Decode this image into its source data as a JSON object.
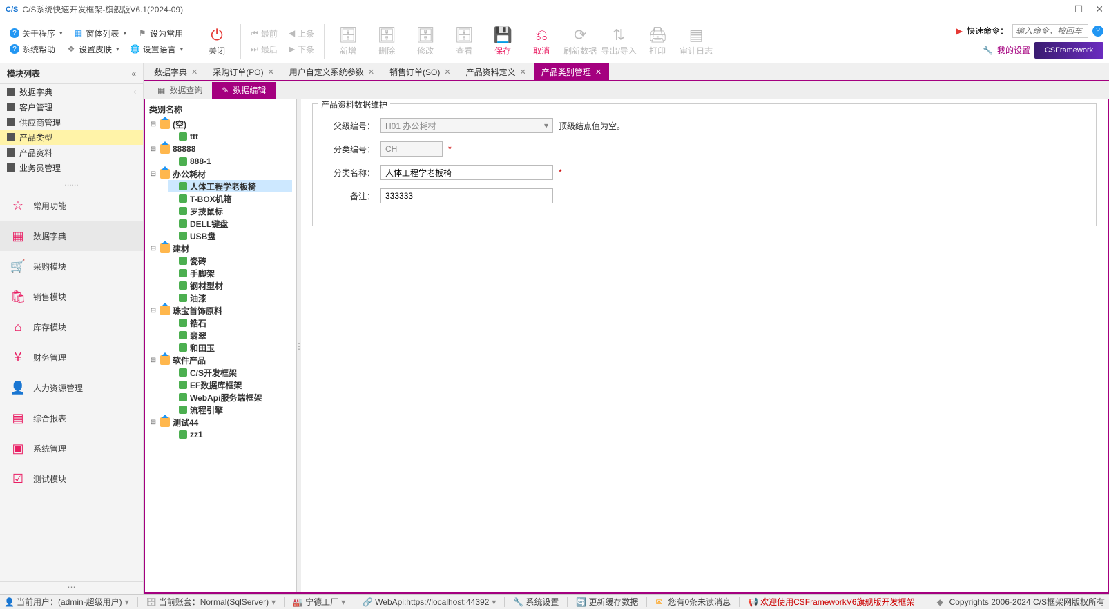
{
  "window": {
    "title": "C/S系统快速开发框架-旗舰版V6.1(2024-09)",
    "logo": "C/S"
  },
  "menu": {
    "about": "关于程序",
    "windows": "窗体列表",
    "set_default": "设为常用",
    "help": "系统帮助",
    "skin": "设置皮肤",
    "lang": "设置语言"
  },
  "nav": {
    "first": "最前",
    "prev": "上条",
    "last": "最后",
    "next": "下条"
  },
  "toolbar": {
    "close": "关闭",
    "add": "新增",
    "delete": "删除",
    "edit": "修改",
    "view": "查看",
    "save": "保存",
    "cancel": "取消",
    "refresh": "刷新数据",
    "export": "导出/导入",
    "print": "打印",
    "audit": "审计日志"
  },
  "quick": {
    "label": "快速命令：",
    "placeholder": "输入命令，按回车",
    "settings": "我的设置",
    "badge": "CSFramework"
  },
  "left": {
    "header": "模块列表",
    "items": [
      {
        "label": "数据字典",
        "chev": true
      },
      {
        "label": "客户管理"
      },
      {
        "label": "供应商管理"
      },
      {
        "label": "产品类型",
        "selected": true
      },
      {
        "label": "产品资料"
      },
      {
        "label": "业务员管理"
      }
    ],
    "ellipsis": "......",
    "big": [
      {
        "label": "常用功能",
        "icon": "☆"
      },
      {
        "label": "数据字典",
        "icon": "▦",
        "active": true
      },
      {
        "label": "采购模块",
        "icon": "🛒"
      },
      {
        "label": "销售模块",
        "icon": "🛍"
      },
      {
        "label": "库存模块",
        "icon": "⌂"
      },
      {
        "label": "财务管理",
        "icon": "¥"
      },
      {
        "label": "人力资源管理",
        "icon": "👤"
      },
      {
        "label": "综合报表",
        "icon": "▤"
      },
      {
        "label": "系统管理",
        "icon": "▣"
      },
      {
        "label": "测试模块",
        "icon": "☑"
      }
    ]
  },
  "tabs": [
    {
      "label": "数据字典",
      "close": true
    },
    {
      "label": "采购订单(PO)",
      "close": true
    },
    {
      "label": "用户自定义系统参数",
      "close": true
    },
    {
      "label": "销售订单(SO)",
      "close": true
    },
    {
      "label": "产品资料定义",
      "close": true
    },
    {
      "label": "产品类别管理",
      "close": true,
      "active": true
    }
  ],
  "subtabs": {
    "query": "数据查询",
    "edit": "数据编辑"
  },
  "tree": {
    "title": "类别名称",
    "nodes": [
      {
        "label": "(空)",
        "children": [
          {
            "label": "ttt"
          }
        ]
      },
      {
        "label": "88888",
        "children": [
          {
            "label": "888-1"
          }
        ]
      },
      {
        "label": "办公耗材",
        "children": [
          {
            "label": "人体工程学老板椅",
            "selected": true
          },
          {
            "label": "T-BOX机箱"
          },
          {
            "label": "罗技鼠标"
          },
          {
            "label": "DELL键盘"
          },
          {
            "label": "USB盘"
          }
        ]
      },
      {
        "label": "建材",
        "children": [
          {
            "label": "瓷砖"
          },
          {
            "label": "手脚架"
          },
          {
            "label": "钢材型材"
          },
          {
            "label": "油漆"
          }
        ]
      },
      {
        "label": "珠宝首饰原料",
        "children": [
          {
            "label": "锆石"
          },
          {
            "label": "翡翠"
          },
          {
            "label": "和田玉"
          }
        ]
      },
      {
        "label": "软件产品",
        "children": [
          {
            "label": "C/S开发框架"
          },
          {
            "label": "EF数据库框架"
          },
          {
            "label": "WebApi服务端框架"
          },
          {
            "label": "流程引擎"
          }
        ]
      },
      {
        "label": "测试44",
        "children": [
          {
            "label": "zz1"
          }
        ]
      }
    ]
  },
  "form": {
    "legend": "产品资料数据维护",
    "parent_label": "父级编号：",
    "parent_value": "H01 办公耗材",
    "parent_hint": "顶级结点值为空。",
    "code_label": "分类编号：",
    "code_value": "CH",
    "name_label": "分类名称：",
    "name_value": "人体工程学老板椅",
    "remark_label": "备注：",
    "remark_value": "333333"
  },
  "status": {
    "user": "当前用户：(admin-超级用户)",
    "account": "当前账套：Normal(SqlServer)",
    "factory": "宁德工厂",
    "webapi": "WebApi:https://localhost:44392",
    "sys_settings": "系统设置",
    "update_cache": "更新缓存数据",
    "unread": "您有0条未读消息",
    "welcome": "欢迎使用CSFrameworkV6旗舰版开发框架",
    "copyright": "Copyrights 2006-2024 C/S框架网版权所有"
  }
}
